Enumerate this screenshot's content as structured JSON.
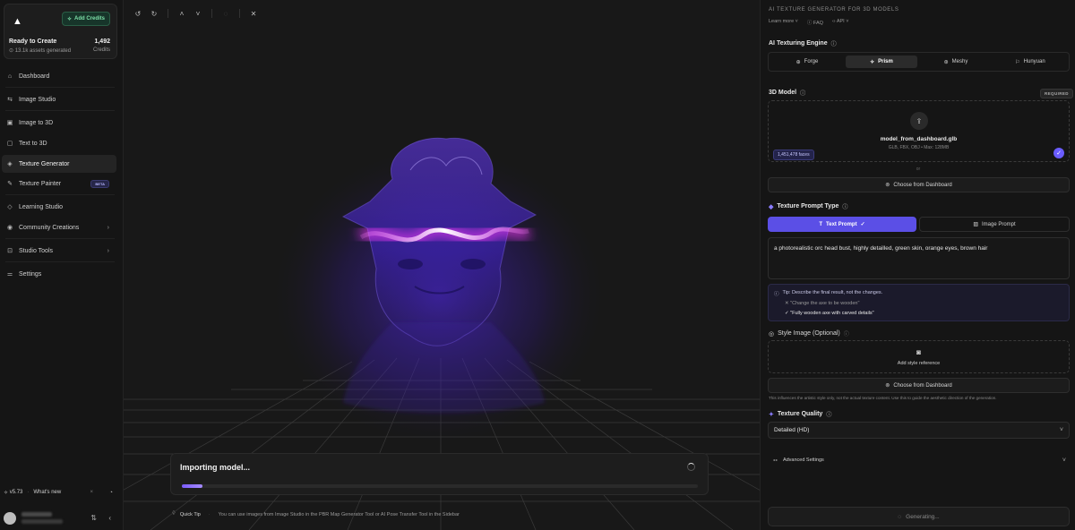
{
  "sidebar": {
    "add_credits": "Add Credits",
    "status_title": "Ready to Create",
    "assets_generated": "13.1k assets generated",
    "credits_value": "1,492",
    "credits_label": "Credits",
    "nav": [
      {
        "label": "Dashboard",
        "icon": "home-icon"
      },
      {
        "label": "Image Studio",
        "icon": "image-studio-icon"
      },
      {
        "label": "Image to 3D",
        "icon": "cube-icon"
      },
      {
        "label": "Text to 3D",
        "icon": "text-icon"
      },
      {
        "label": "Texture Generator",
        "icon": "layers-icon",
        "active": true
      },
      {
        "label": "Texture Painter",
        "icon": "brush-icon",
        "badge": "BETA"
      },
      {
        "label": "Learning Studio",
        "icon": "graduation-icon"
      },
      {
        "label": "Community Creations",
        "icon": "globe-icon",
        "chevron": true
      },
      {
        "label": "Studio Tools",
        "icon": "tools-icon",
        "chevron": true
      },
      {
        "label": "Settings",
        "icon": "sliders-icon"
      }
    ],
    "version": "v5.73",
    "whats_new": "What's new"
  },
  "viewport": {
    "importing_title": "Importing model...",
    "import_progress": 0.04,
    "quick_tip_label": "Quick Tip",
    "quick_tip_text": "You can use images from Image Studio in the PBR Map Generator Tool or AI Pose Transfer Tool in the Sidebar"
  },
  "panel": {
    "header": "AI TEXTURE GENERATOR FOR 3D MODELS",
    "links": [
      "Learn more",
      "FAQ",
      "API"
    ],
    "engine_label": "AI Texturing Engine",
    "engines": [
      {
        "label": "Forge",
        "icon": "target-icon"
      },
      {
        "label": "Prism",
        "icon": "sparkle-icon",
        "active": true
      },
      {
        "label": "Meshy",
        "icon": "mesh-icon"
      },
      {
        "label": "Hunyuan",
        "icon": "hunyuan-icon"
      }
    ],
    "model_label": "3D Model",
    "required": "REQUIRED",
    "file_name": "model_from_dashboard.glb",
    "file_meta": "GLB, FBX, OBJ • Max: 128MB",
    "faces": "1,451,478 faces",
    "or": "or",
    "choose_dashboard": "Choose from Dashboard",
    "prompt_type_label": "Texture Prompt Type",
    "text_prompt": "Text Prompt",
    "image_prompt": "Image Prompt",
    "prompt_text": "a photorealistic orc head bust, highly detailled, green skin, orange eyes, brown hair",
    "tip_title": "Tip: Describe the final result, not the changes.",
    "tip_bad": "\"Change the axe to be wooden\"",
    "tip_good": "\"Fully wooden axe with carved details\"",
    "style_label": "Style Image (Optional)",
    "add_style": "Add style reference",
    "choose_dashboard_2": "Choose from Dashboard",
    "style_note": "This influences the artistic style only, not the actual texture content. Use this to guide the aesthetic direction of the generation.",
    "quality_label": "Texture Quality",
    "quality_value": "Detailed (HD)",
    "advanced": "Advanced Settings",
    "generating": "Generating..."
  },
  "colors": {
    "accent": "#5b4fe6",
    "beam": "#ff3cff",
    "credits_green": "#7de0a8"
  }
}
